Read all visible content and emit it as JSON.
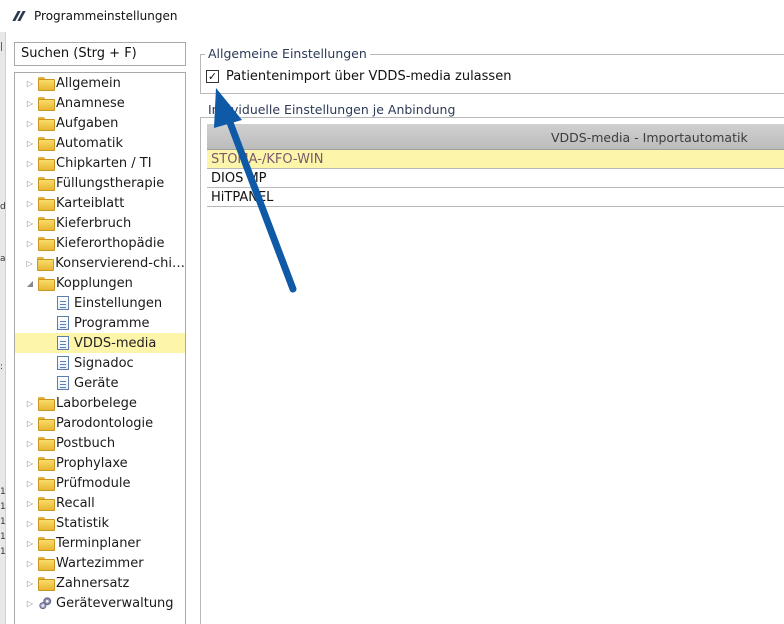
{
  "window": {
    "title": "Programmeinstellungen"
  },
  "search": {
    "placeholder": "Suchen (Strg + F)"
  },
  "left_strip_marks": [
    "|",
    "d",
    "a",
    ":",
    "1",
    "1",
    "1",
    "1",
    "1"
  ],
  "tree": {
    "items": [
      {
        "label": "Allgemein",
        "type": "folder",
        "expander": "▷",
        "level": 0
      },
      {
        "label": "Anamnese",
        "type": "folder",
        "expander": "▷",
        "level": 0
      },
      {
        "label": "Aufgaben",
        "type": "folder",
        "expander": "▷",
        "level": 0
      },
      {
        "label": "Automatik",
        "type": "folder",
        "expander": "▷",
        "level": 0
      },
      {
        "label": "Chipkarten / TI",
        "type": "folder",
        "expander": "▷",
        "level": 0
      },
      {
        "label": "Füllungstherapie",
        "type": "folder",
        "expander": "▷",
        "level": 0
      },
      {
        "label": "Karteiblatt",
        "type": "folder",
        "expander": "▷",
        "level": 0
      },
      {
        "label": "Kieferbruch",
        "type": "folder",
        "expander": "▷",
        "level": 0
      },
      {
        "label": "Kieferorthopädie",
        "type": "folder",
        "expander": "▷",
        "level": 0
      },
      {
        "label": "Konservierend-chi…",
        "type": "folder",
        "expander": "▷",
        "level": 0
      },
      {
        "label": "Kopplungen",
        "type": "folder",
        "expander": "◢",
        "level": 0
      },
      {
        "label": "Einstellungen",
        "type": "page",
        "expander": "",
        "level": 1
      },
      {
        "label": "Programme",
        "type": "page",
        "expander": "",
        "level": 1
      },
      {
        "label": "VDDS-media",
        "type": "page",
        "expander": "",
        "level": 1,
        "selected": true
      },
      {
        "label": "Signadoc",
        "type": "page",
        "expander": "",
        "level": 1
      },
      {
        "label": "Geräte",
        "type": "page",
        "expander": "",
        "level": 1
      },
      {
        "label": "Laborbelege",
        "type": "folder",
        "expander": "▷",
        "level": 0
      },
      {
        "label": "Parodontologie",
        "type": "folder",
        "expander": "▷",
        "level": 0
      },
      {
        "label": "Postbuch",
        "type": "folder",
        "expander": "▷",
        "level": 0
      },
      {
        "label": "Prophylaxe",
        "type": "folder",
        "expander": "▷",
        "level": 0
      },
      {
        "label": "Prüfmodule",
        "type": "folder",
        "expander": "▷",
        "level": 0
      },
      {
        "label": "Recall",
        "type": "folder",
        "expander": "▷",
        "level": 0
      },
      {
        "label": "Statistik",
        "type": "folder",
        "expander": "▷",
        "level": 0
      },
      {
        "label": "Terminplaner",
        "type": "folder",
        "expander": "▷",
        "level": 0
      },
      {
        "label": "Wartezimmer",
        "type": "folder",
        "expander": "▷",
        "level": 0
      },
      {
        "label": "Zahnersatz",
        "type": "folder",
        "expander": "▷",
        "level": 0
      },
      {
        "label": "Geräteverwaltung",
        "type": "gear",
        "expander": "▷",
        "level": 0
      }
    ]
  },
  "general": {
    "title": "Allgemeine Einstellungen",
    "checkbox_label": "Patientenimport über VDDS-media zulassen",
    "checkbox_mark": "✓",
    "checked": true
  },
  "individual": {
    "title": "Individuelle Einstellungen je Anbindung",
    "column_header": "VDDS-media - Importautomatik",
    "rows": [
      {
        "name": "STOMA-/KFO-WIN",
        "selected": true
      },
      {
        "name": "DIOS MP",
        "selected": false
      },
      {
        "name": "HiTPANEL",
        "selected": false
      }
    ]
  },
  "colors": {
    "selection": "#fdf5a9",
    "arrow": "#0e5aa7",
    "group_title": "#2d3a55"
  }
}
